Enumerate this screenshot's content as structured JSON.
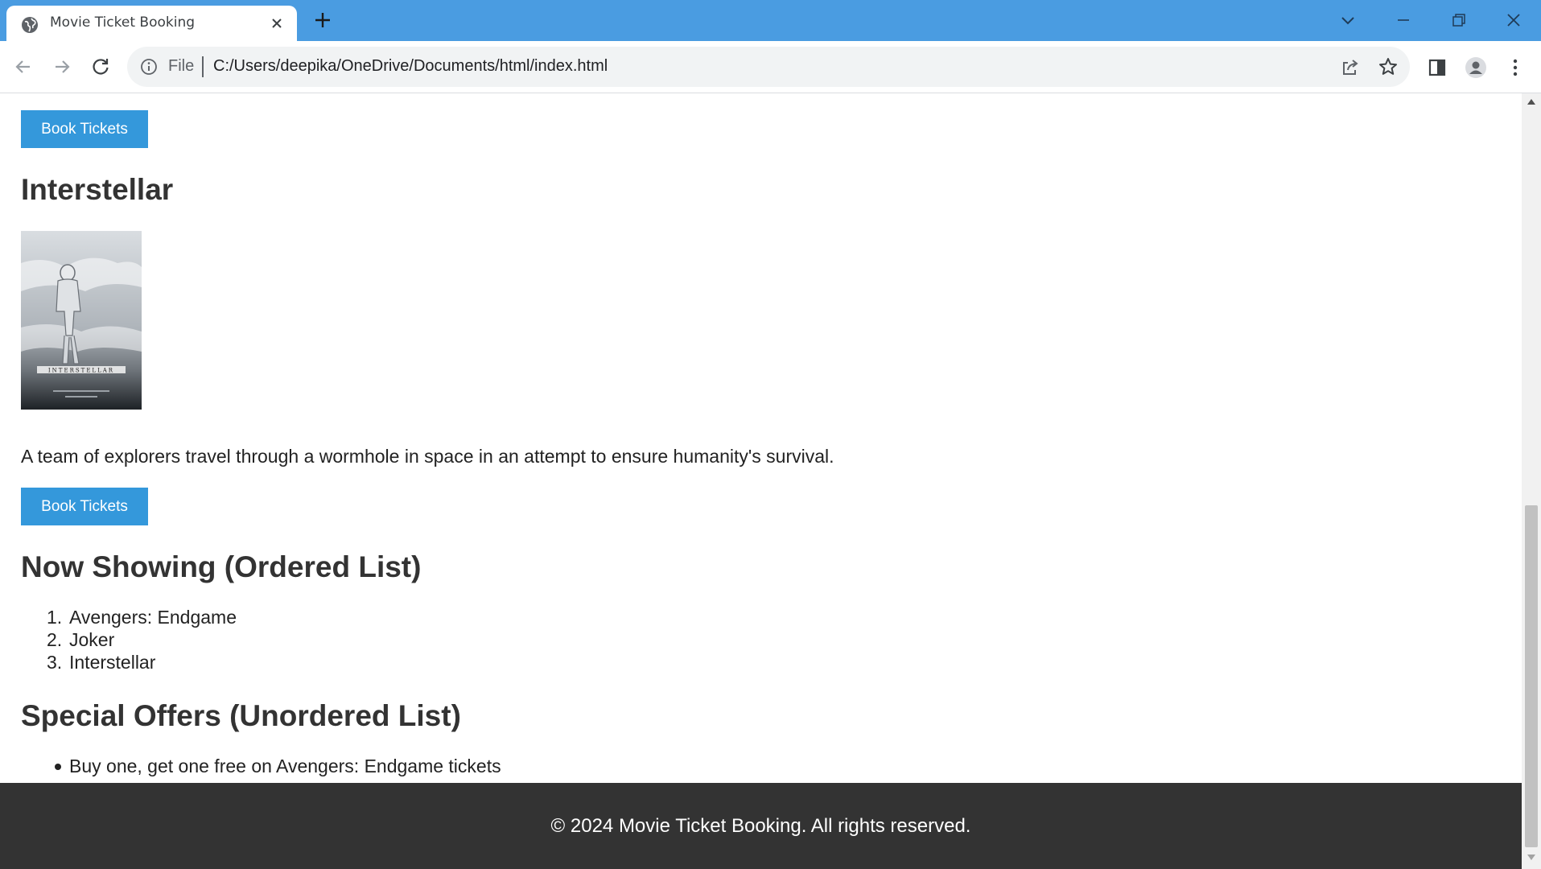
{
  "browser": {
    "tab_title": "Movie Ticket Booking",
    "omnibox": {
      "scheme_label": "File",
      "url": "C:/Users/deepika/OneDrive/Documents/html/index.html"
    },
    "icons": {
      "favicon": "globe-icon",
      "close": "close-icon",
      "new_tab": "plus-icon",
      "back": "back-arrow-icon",
      "forward": "forward-arrow-icon",
      "reload": "reload-icon",
      "info": "info-icon",
      "share": "share-icon",
      "bookmark": "star-icon",
      "side_panel": "side-panel-icon",
      "profile": "profile-icon",
      "menu": "kebab-menu-icon"
    },
    "colors": {
      "tabbar": "#4a9ce1"
    }
  },
  "page": {
    "book_button_top": "Book Tickets",
    "movie": {
      "title": "Interstellar",
      "poster_caption": "INTERSTELLAR",
      "description": "A team of explorers travel through a wormhole in space in an attempt to ensure humanity's survival.",
      "book_button": "Book Tickets"
    },
    "now_showing": {
      "heading": "Now Showing (Ordered List)",
      "items": [
        {
          "num": "1.",
          "label": "Avengers: Endgame"
        },
        {
          "num": "2.",
          "label": "Joker"
        },
        {
          "num": "3.",
          "label": "Interstellar"
        }
      ]
    },
    "special_offers": {
      "heading": "Special Offers (Unordered List)",
      "items": [
        "Buy one, get one free on Avengers: Endgame tickets"
      ]
    },
    "footer": "© 2024 Movie Ticket Booking. All rights reserved.",
    "colors": {
      "button": "#3498db",
      "footer_bg": "#333333",
      "heading": "#333333"
    }
  }
}
